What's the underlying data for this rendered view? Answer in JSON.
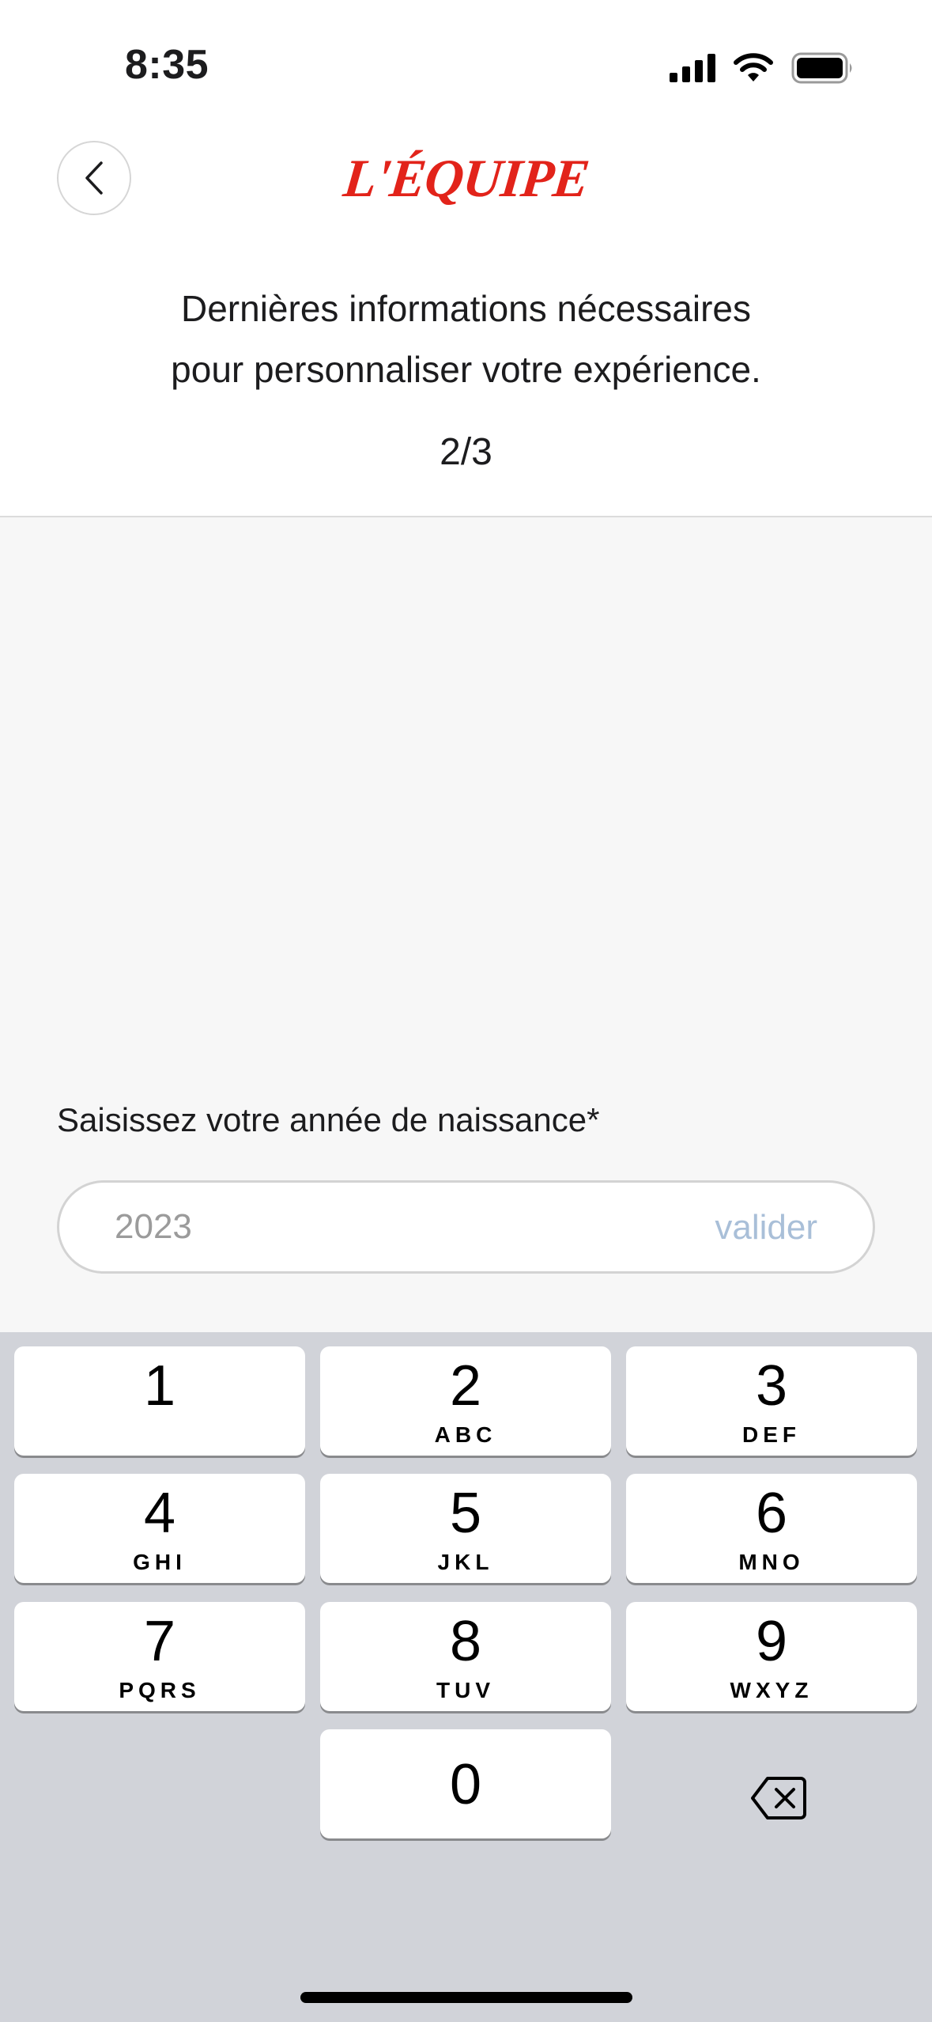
{
  "status_bar": {
    "time": "8:35",
    "icons": [
      "cellular-signal-icon",
      "wifi-icon",
      "battery-icon"
    ]
  },
  "header": {
    "back_icon": "chevron-left-icon",
    "logo_text": "L'ÉQUIPE",
    "intro_line1": "Dernières informations nécessaires",
    "intro_line2": "pour personnaliser votre expérience.",
    "step": "2/3"
  },
  "form": {
    "label": "Saisissez votre année de naissance*",
    "placeholder": "2023",
    "value": "",
    "validate_label": "valider"
  },
  "keyboard": {
    "keys": [
      {
        "digit": "1",
        "letters": ""
      },
      {
        "digit": "2",
        "letters": "ABC"
      },
      {
        "digit": "3",
        "letters": "DEF"
      },
      {
        "digit": "4",
        "letters": "GHI"
      },
      {
        "digit": "5",
        "letters": "JKL"
      },
      {
        "digit": "6",
        "letters": "MNO"
      },
      {
        "digit": "7",
        "letters": "PQRS"
      },
      {
        "digit": "8",
        "letters": "TUV"
      },
      {
        "digit": "9",
        "letters": "WXYZ"
      },
      {
        "digit": "0",
        "letters": ""
      }
    ],
    "delete_icon": "backspace-icon"
  },
  "colors": {
    "brand_red": "#e2231a",
    "validate_text": "#a9bfd8",
    "keyboard_bg": "#d1d3d9",
    "content_bg": "#f7f7f7"
  }
}
